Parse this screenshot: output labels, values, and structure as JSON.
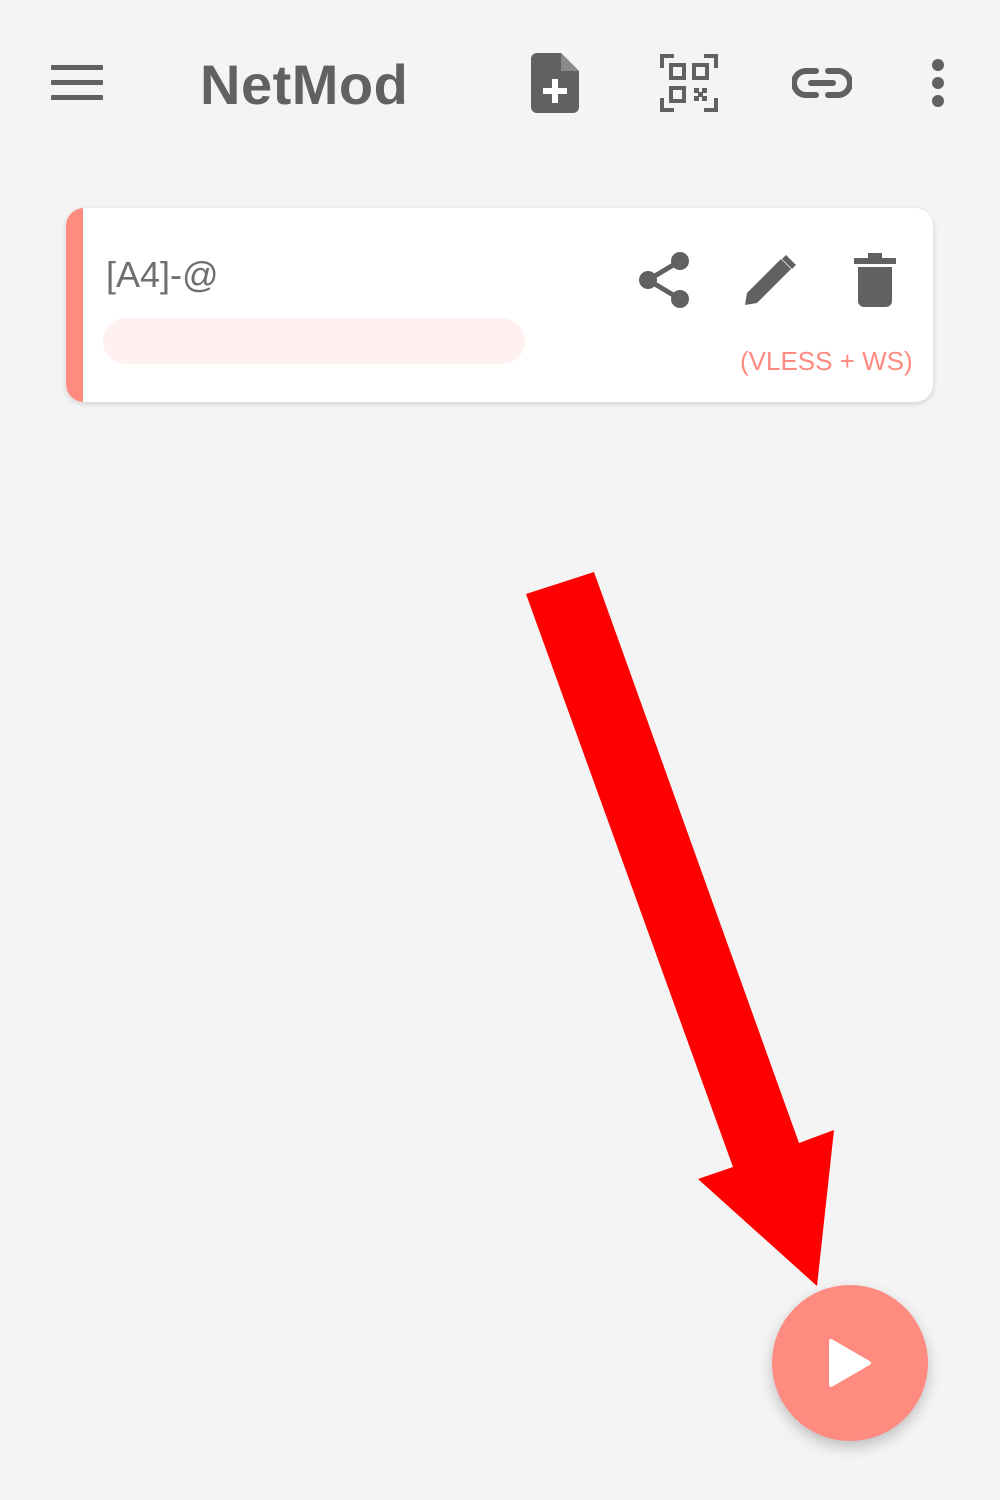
{
  "toolbar": {
    "title": "NetMod",
    "icons": {
      "menu": "menu-icon",
      "add_file": "add-file-icon",
      "qr_scan": "qr-code-icon",
      "link": "link-icon",
      "more": "more-vert-icon"
    }
  },
  "profiles": [
    {
      "title": "[A4]-@",
      "type": "(VLESS + WS)",
      "actions": [
        "share-icon",
        "edit-icon",
        "delete-icon"
      ]
    }
  ],
  "fab": {
    "icon": "play-icon"
  },
  "colors": {
    "accent": "#ff8a80",
    "annotation_arrow": "#ff0000",
    "toolbar_icons": "#616161",
    "background": "#f4f4f4"
  }
}
